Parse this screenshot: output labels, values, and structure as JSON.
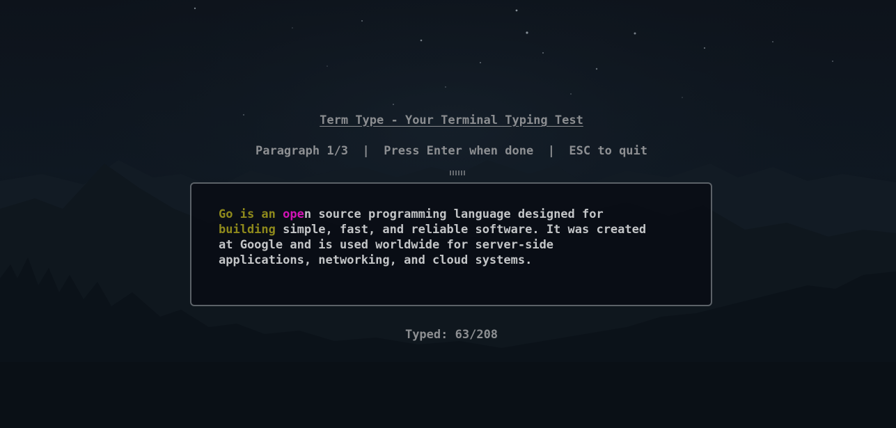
{
  "header": {
    "title": "Term Type - Your Terminal Typing Test",
    "paragraph_indicator": "Paragraph 1/3",
    "separator": "|",
    "enter_hint": "Press Enter when done",
    "quit_hint": "ESC to quit"
  },
  "passage": {
    "typed_text": "Go is an ",
    "error_text": "ope",
    "remaining_line1": "n source programming language designed for\n",
    "typed_text_line2": "building",
    "remaining_text": " simple, fast, and reliable software. It was created\nat Google and is used worldwide for server-side\napplications, networking, and cloud systems."
  },
  "progress": {
    "label": "Typed:",
    "typed": 63,
    "total": 208,
    "display": "63/208"
  },
  "colors": {
    "typed": "#8f8a1c",
    "error": "#d313b6",
    "untyped": "#c3c5c7",
    "border": "#5c6268"
  }
}
